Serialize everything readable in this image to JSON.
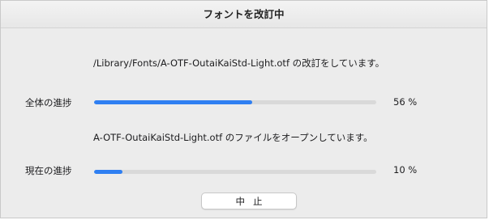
{
  "window": {
    "title": "フォントを改訂中"
  },
  "status": {
    "overall_message": "/Library/Fonts/A-OTF-OutaiKaiStd-Light.otf の改訂をしています。",
    "file_message": "A-OTF-OutaiKaiStd-Light.otf のファイルをオープンしています。"
  },
  "progress": {
    "total": {
      "label": "全体の進捗",
      "value": 56,
      "value_text": "56 %"
    },
    "current": {
      "label": "現在の進捗",
      "value": 10,
      "value_text": "10 %"
    },
    "fill_color": "#2f7ff2",
    "track_color": "#d9d9d9"
  },
  "buttons": {
    "stop_label": "中止"
  }
}
